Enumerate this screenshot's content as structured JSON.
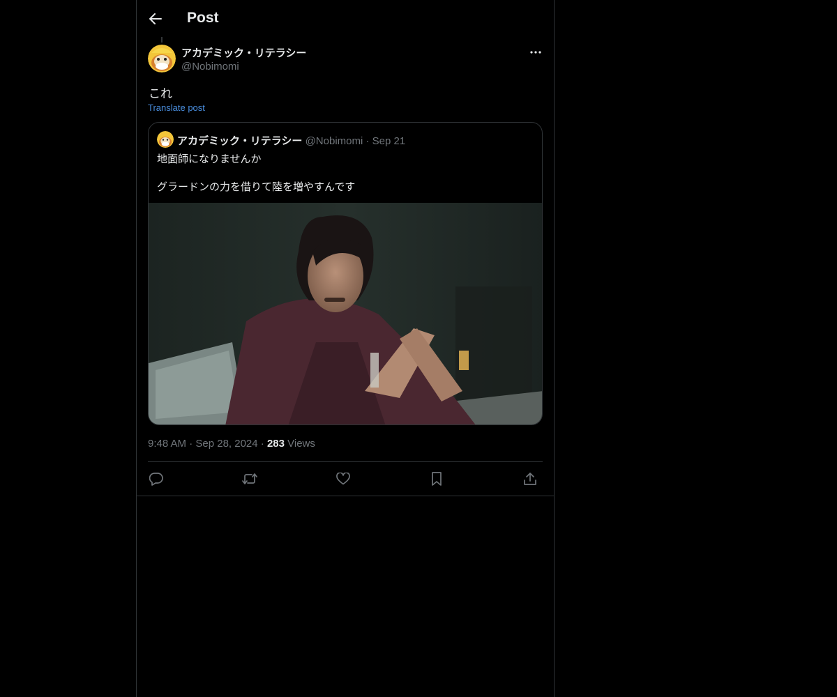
{
  "header": {
    "title": "Post",
    "back_icon": "arrow-left-icon"
  },
  "post": {
    "author_name": "アカデミック・リテラシー",
    "author_handle": "@Nobimomi",
    "text": "これ",
    "translate_label": "Translate post",
    "more_icon": "ellipsis-icon",
    "timestamp": "9:48 AM · Sep 28, 2024 · ",
    "views_count": "283",
    "views_label": " Views"
  },
  "quote": {
    "author_name": "アカデミック・リテラシー",
    "author_handle": "@Nobimomi",
    "separator": "·",
    "date": "Sep 21",
    "line1": "地面師になりませんか",
    "line2": "グラードンの力を借りて陸を増やすんです"
  },
  "actions": [
    {
      "name": "reply-icon"
    },
    {
      "name": "repost-icon"
    },
    {
      "name": "like-icon"
    },
    {
      "name": "bookmark-icon"
    },
    {
      "name": "share-icon"
    }
  ],
  "colors": {
    "background": "#000000",
    "text_primary": "#e7e9ea",
    "text_secondary": "#71767b",
    "link": "#4a8fe0",
    "border": "#2f3336"
  }
}
